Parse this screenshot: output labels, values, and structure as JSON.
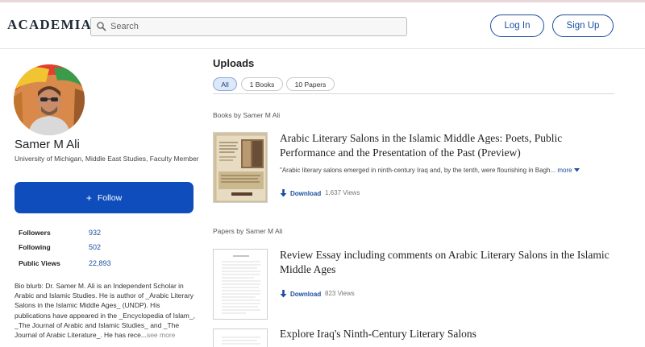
{
  "header": {
    "logo": "ACADEMIA",
    "search_placeholder": "Search",
    "login_label": "Log In",
    "signup_label": "Sign Up"
  },
  "profile": {
    "name": "Samer M Ali",
    "affiliation": "University of Michigan, Middle East Studies, Faculty Member",
    "follow_label": "Follow",
    "stats": [
      {
        "label": "Followers",
        "value": "932"
      },
      {
        "label": "Following",
        "value": "502"
      },
      {
        "label": "Public Views",
        "value": "22,893"
      }
    ],
    "bio": "Bio blurb:      Dr. Samer M. Ali is an Independent Scholar in Arabic and Islamic Studies. He is author of _Arabic Literary Salons in the Islamic Middle Ages_ (UNDP). His publications have appeared in the _Encyclopedia of Islam_, _The Journal of Arabic and Islamic Studies_ and _The Journal of Arabic Literature_. He has rece...",
    "bio_more": "see more"
  },
  "uploads": {
    "title": "Uploads",
    "filters": [
      {
        "label": "All",
        "active": true
      },
      {
        "label": "1 Books",
        "active": false
      },
      {
        "label": "10 Papers",
        "active": false
      }
    ],
    "books_label": "Books by Samer M Ali",
    "book": {
      "title": "Arabic Literary Salons in the Islamic Middle Ages: Poets, Public Performance and the Presentation of the Past (Preview)",
      "abstract": "\"Arabic literary salons emerged in ninth-century Iraq and, by the tenth, were flourishing in Bagh...",
      "more_label": "more",
      "download_label": "Download",
      "views": "1,637 Views"
    },
    "papers_label": "Papers by Samer M Ali",
    "papers": [
      {
        "title": "Review Essay including comments on Arabic Literary Salons in the Islamic Middle Ages",
        "download_label": "Download",
        "views": "823 Views"
      },
      {
        "title": "Explore Iraq's Ninth-Century Literary Salons"
      }
    ]
  },
  "colors": {
    "accent": "#0f4dbc",
    "link": "#1b4fa0"
  }
}
